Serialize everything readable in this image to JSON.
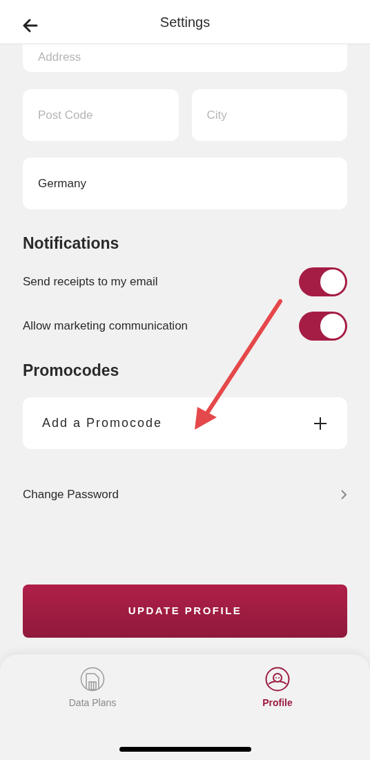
{
  "header": {
    "title": "Settings"
  },
  "address_fields": [
    {
      "placeholder": "Address"
    }
  ],
  "postal_fields": [
    {
      "placeholder": "Post Code"
    },
    {
      "placeholder": "City"
    }
  ],
  "country_field": {
    "value": "Germany"
  },
  "notifications": {
    "title": "Notifications",
    "toggles": [
      {
        "label": "Send receipts to my email",
        "on": true
      },
      {
        "label": "Allow marketing communication",
        "on": true
      }
    ]
  },
  "promocodes": {
    "title": "Promocodes",
    "add_label": "Add a Promocode"
  },
  "change_password": {
    "label": "Change Password"
  },
  "update_button": {
    "label": "UPDATE PROFILE"
  },
  "bottom_nav": [
    {
      "label": "Data Plans",
      "kind": "sim",
      "selected": false
    },
    {
      "label": "Profile",
      "kind": "profile",
      "selected": true
    }
  ],
  "annotation": {
    "kind": "arrow"
  }
}
